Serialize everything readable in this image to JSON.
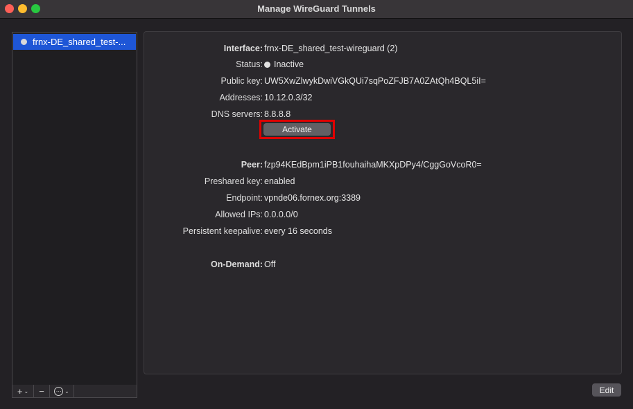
{
  "window": {
    "title": "Manage WireGuard Tunnels"
  },
  "sidebar": {
    "items": [
      {
        "label": "frnx-DE_shared_test-..."
      }
    ],
    "toolbar": {
      "add": "+",
      "remove": "−",
      "more": "⋯"
    }
  },
  "interface": {
    "interface_label": "Interface:",
    "interface_value": "frnx-DE_shared_test-wireguard (2)",
    "status_label": "Status:",
    "status_value": "Inactive",
    "public_key_label": "Public key:",
    "public_key_value": "UW5XwZlwykDwiVGkQUi7sqPoZFJB7A0ZAtQh4BQL5iI=",
    "addresses_label": "Addresses:",
    "addresses_value": "10.12.0.3/32",
    "dns_label": "DNS servers:",
    "dns_value": "8.8.8.8",
    "activate_label": "Activate"
  },
  "peer": {
    "peer_label": "Peer:",
    "peer_value": "fzp94KEdBpm1iPB1fouhaihaMKXpDPy4/CggGoVcoR0=",
    "preshared_label": "Preshared key:",
    "preshared_value": "enabled",
    "endpoint_label": "Endpoint:",
    "endpoint_value": "vpnde06.fornex.org:3389",
    "allowed_ips_label": "Allowed IPs:",
    "allowed_ips_value": "0.0.0.0/0",
    "keepalive_label": "Persistent keepalive:",
    "keepalive_value": "every 16 seconds"
  },
  "on_demand": {
    "label": "On-Demand:",
    "value": "Off"
  },
  "footer": {
    "edit_label": "Edit"
  },
  "colors": {
    "selection": "#1e56d6",
    "highlight_box": "#e00000",
    "background": "#232125"
  }
}
